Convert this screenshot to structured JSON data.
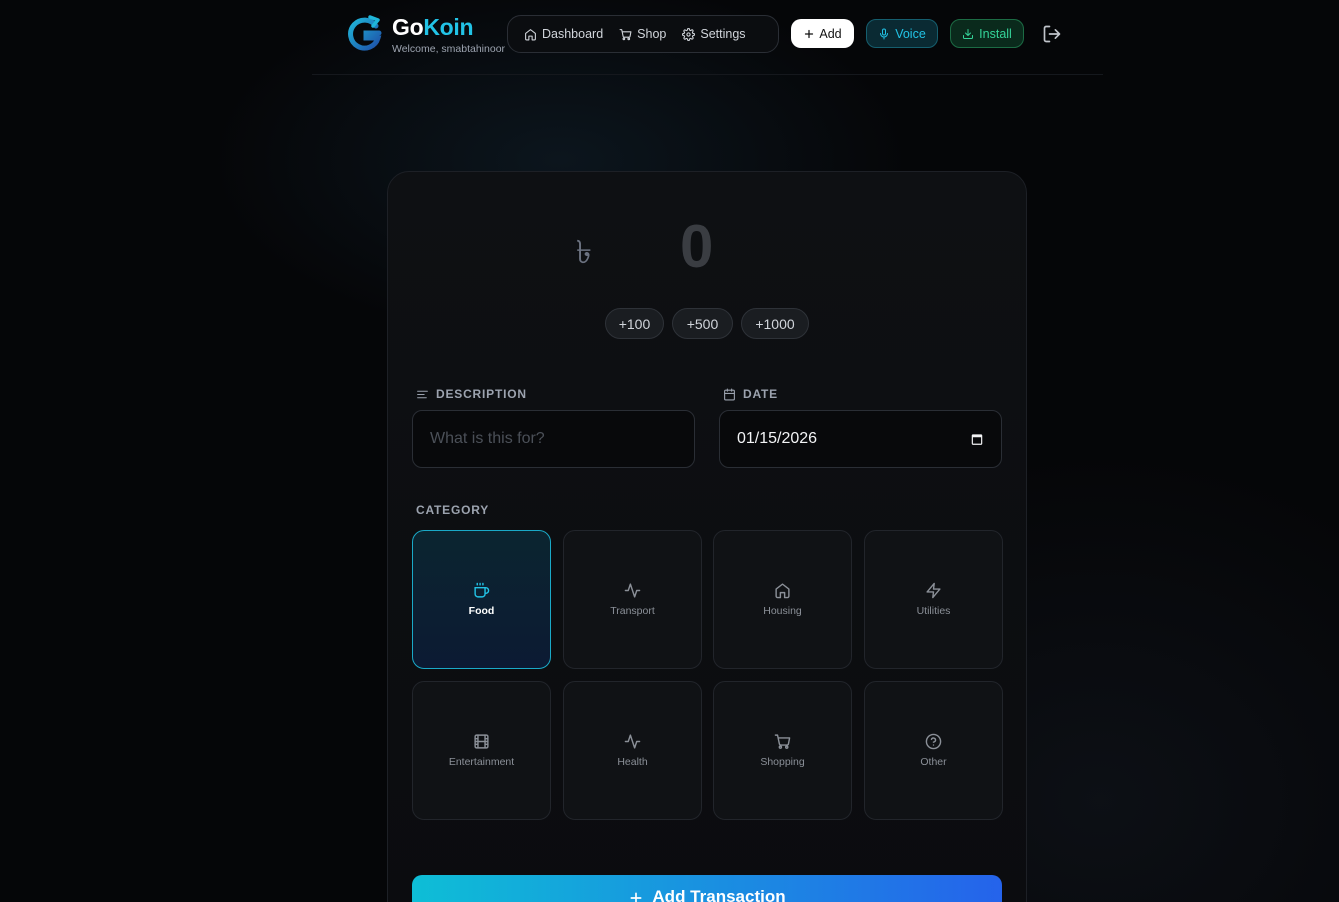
{
  "brand": {
    "name_part1": "Go",
    "name_part2": "Koin",
    "welcome": "Welcome, smabtahinoor"
  },
  "nav": [
    {
      "label": "Dashboard",
      "icon": "home-icon"
    },
    {
      "label": "Shop",
      "icon": "cart-icon"
    },
    {
      "label": "Settings",
      "icon": "gear-icon"
    }
  ],
  "actions": {
    "add_label": "Add",
    "voice_label": "Voice",
    "install_label": "Install"
  },
  "amount": {
    "currency_symbol": "৳",
    "value": "0"
  },
  "quick_add": [
    "+100",
    "+500",
    "+1000"
  ],
  "form": {
    "description_label": "DESCRIPTION",
    "description_placeholder": "What is this for?",
    "date_label": "DATE",
    "date_value": "01/15/2026",
    "category_label": "CATEGORY"
  },
  "categories": [
    {
      "label": "Food",
      "icon": "coffee-icon",
      "selected": true
    },
    {
      "label": "Transport",
      "icon": "activity-icon",
      "selected": false
    },
    {
      "label": "Housing",
      "icon": "home-icon",
      "selected": false
    },
    {
      "label": "Utilities",
      "icon": "zap-icon",
      "selected": false
    },
    {
      "label": "Entertainment",
      "icon": "film-icon",
      "selected": false
    },
    {
      "label": "Health",
      "icon": "activity-icon",
      "selected": false
    },
    {
      "label": "Shopping",
      "icon": "cart-icon",
      "selected": false
    },
    {
      "label": "Other",
      "icon": "help-circle-icon",
      "selected": false
    }
  ],
  "submit_label": "Add Transaction",
  "colors": {
    "accent": "#22c3e6",
    "success": "#34d399",
    "gradient_start": "#0ebed6",
    "gradient_end": "#2563eb"
  }
}
